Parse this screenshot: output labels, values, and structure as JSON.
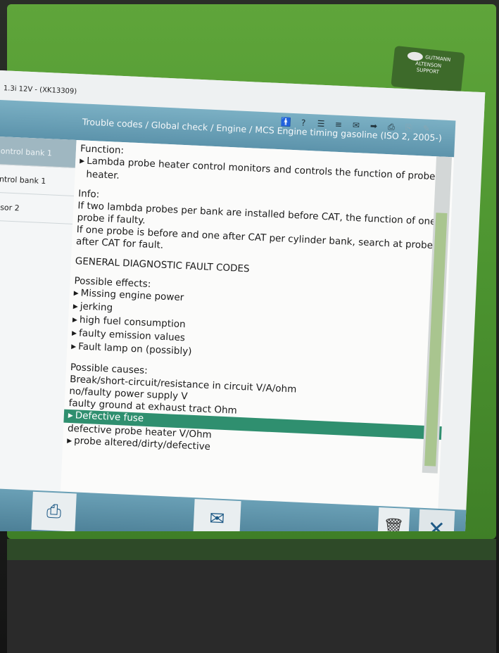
{
  "window": {
    "title": "1.3i 12V - (XK13309)"
  },
  "logo": {
    "line1": "GUTMANN",
    "line2": "ALTENSON",
    "line3": "SUPPORT"
  },
  "breadcrumb": "Trouble codes / Global check / Engine / MCS Engine timing gasoline (ISO 2, 2005-)",
  "toolbar": {
    "icons": [
      "person-icon",
      "help-icon",
      "cart-icon",
      "list-icon",
      "mail-icon",
      "arrow-icon",
      "print-icon",
      "copy-icon",
      "edit-icon"
    ]
  },
  "sidebar": {
    "items": [
      {
        "label": "ontrol bank 1",
        "active": true
      },
      {
        "label": "ntrol bank 1",
        "active": false
      },
      {
        "label": "isor 2",
        "active": false
      }
    ]
  },
  "content": {
    "function_heading": "Function:",
    "function_line1": "Lambda probe heater control monitors and controls the function of probe",
    "function_line2": "heater.",
    "info_heading": "Info:",
    "info_line1": "If two lambda probes per bank are installed before CAT, the function of one",
    "info_line2": "probe if faulty.",
    "info_line3": "If one probe is before and one after CAT per cylinder bank, search at probe",
    "info_line4": "after CAT for fault.",
    "general_codes": "GENERAL DIAGNOSTIC FAULT CODES",
    "effects_heading": "Possible effects:",
    "effects": [
      "Missing engine power",
      "jerking",
      "high fuel consumption",
      "faulty emission values",
      "Fault lamp on (possibly)"
    ],
    "causes_heading": "Possible causes:",
    "cause1": "Break/short-circuit/resistance in circuit V/A/ohm",
    "cause2": "no/faulty power supply V",
    "cause3": "faulty ground at exhaust tract Ohm",
    "cause_highlight": "Defective fuse",
    "cause5": "defective probe heater V/Ohm",
    "cause6": "probe altered/dirty/defective"
  },
  "footer": {
    "print_icon": "printer-icon",
    "support_icon": "lifebuoy-mail-icon",
    "trash_icon": "trash-icon",
    "close_icon": "close-icon"
  },
  "colors": {
    "bezel": "#4c9430",
    "header": "#5c93ab",
    "highlight": "#2f8f6f"
  }
}
